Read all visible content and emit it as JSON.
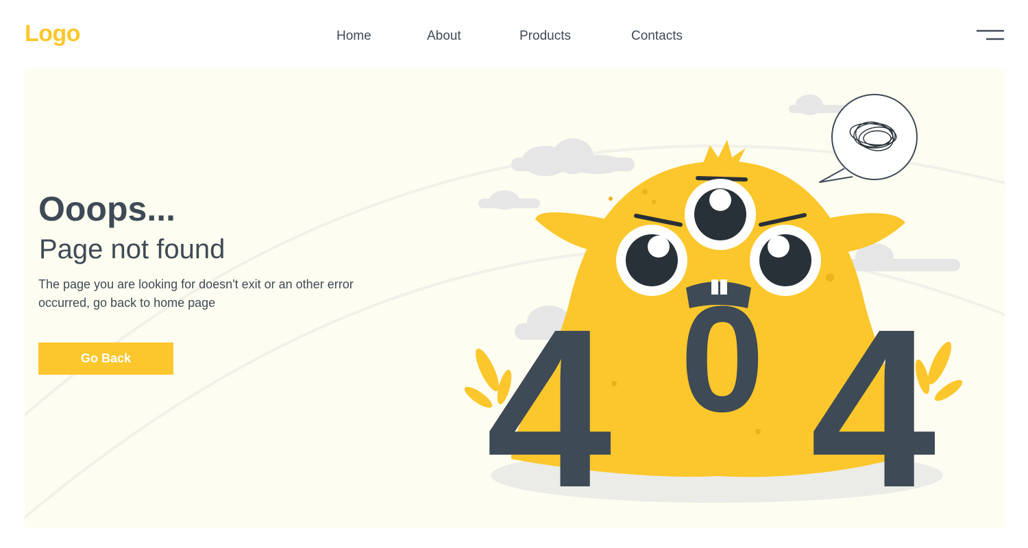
{
  "header": {
    "logo_text": "Logo",
    "nav": {
      "home": "Home",
      "about": "About",
      "products": "Products",
      "contacts": "Contacts"
    },
    "menu_icon": "hamburger-menu-icon"
  },
  "main": {
    "title": "Ooops...",
    "subtitle": "Page not found",
    "description": "The page you are looking for doesn't exit or an other error occurred, go back to home page",
    "button_label": "Go Back",
    "illustration": {
      "icon": "monster-404-illustration",
      "digits": [
        "4",
        "0",
        "4"
      ]
    }
  },
  "colors": {
    "accent": "#fcc72c",
    "text_dark": "#3e4a55",
    "panel_bg": "#fefdf1",
    "cloud": "#e6e6e6"
  }
}
